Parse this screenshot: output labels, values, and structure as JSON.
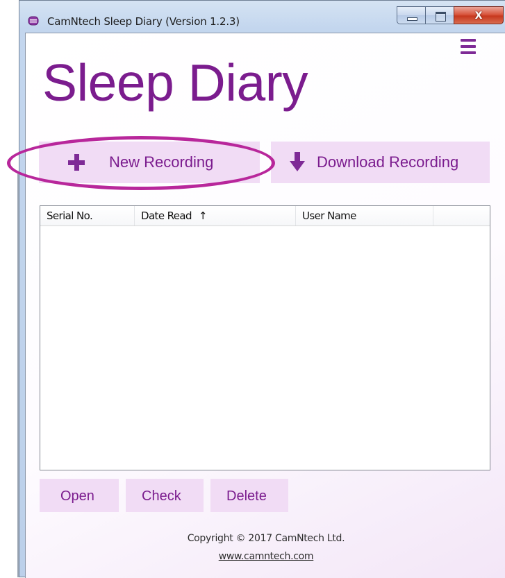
{
  "window": {
    "title": "CamNtech Sleep Diary (Version 1.2.3)",
    "close_glyph": "x",
    "accent_color": "#7b1c8e",
    "button_bg": "#f1dcf5",
    "highlight_color": "#b8279b"
  },
  "header": {
    "title": "Sleep Diary",
    "menu_icon": "hamburger-icon"
  },
  "actions": {
    "new_recording": "New Recording",
    "new_recording_icon": "plus-icon",
    "download_recording": "Download Recording",
    "download_recording_icon": "arrow-down-icon"
  },
  "list": {
    "columns": [
      "Serial No.",
      "Date Read",
      "User Name",
      ""
    ],
    "sort_indicator": "↑",
    "rows": []
  },
  "footer_buttons": {
    "open": "Open",
    "check": "Check",
    "delete": "Delete"
  },
  "footer": {
    "copyright": "Copyright © 2017 CamNtech Ltd.",
    "website": "www.camntech.com"
  }
}
